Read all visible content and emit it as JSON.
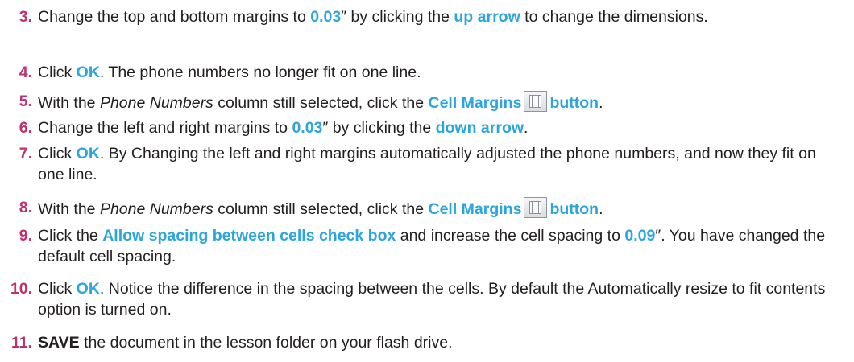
{
  "steps": [
    {
      "number": "3.",
      "segments": [
        {
          "t": "Change the top and bottom margins to "
        },
        {
          "t": "0.03",
          "s": "hl"
        },
        {
          "t": "″ by clicking the "
        },
        {
          "t": "up arrow",
          "s": "hl"
        },
        {
          "t": " to change the dimensions."
        }
      ]
    },
    {
      "number": "4.",
      "segments": [
        {
          "t": "Click "
        },
        {
          "t": "OK",
          "s": "hl"
        },
        {
          "t": ". The phone numbers no longer fit on one line."
        }
      ]
    },
    {
      "number": "5.",
      "segments": [
        {
          "t": "With the "
        },
        {
          "t": "Phone Numbers",
          "s": "i"
        },
        {
          "t": " column still selected, click the "
        },
        {
          "t": "Cell Margins",
          "s": "hl"
        },
        {
          "icon": "cell-margins-icon"
        },
        {
          "t": "button",
          "s": "hl"
        },
        {
          "t": "."
        }
      ]
    },
    {
      "number": "6.",
      "segments": [
        {
          "t": "Change the left and right margins to "
        },
        {
          "t": "0.03",
          "s": "hl"
        },
        {
          "t": "″ by clicking the "
        },
        {
          "t": "down arrow",
          "s": "hl"
        },
        {
          "t": "."
        }
      ]
    },
    {
      "number": "7.",
      "segments": [
        {
          "t": "Click "
        },
        {
          "t": "OK",
          "s": "hl"
        },
        {
          "t": ". By Changing the left and right margins automatically adjusted the phone numbers, and now they fit on one line."
        }
      ]
    },
    {
      "number": "8.",
      "segments": [
        {
          "t": "With the "
        },
        {
          "t": "Phone Numbers",
          "s": "i"
        },
        {
          "t": " column still selected, click the "
        },
        {
          "t": "Cell Margins",
          "s": "hl"
        },
        {
          "icon": "cell-margins-icon"
        },
        {
          "t": "button",
          "s": "hl"
        },
        {
          "t": "."
        }
      ]
    },
    {
      "number": "9.",
      "segments": [
        {
          "t": "Click the "
        },
        {
          "t": "Allow spacing between cells check box",
          "s": "hl"
        },
        {
          "t": " and increase the cell spacing to "
        },
        {
          "t": "0.09",
          "s": "hl"
        },
        {
          "t": "″. You have changed the default cell spacing."
        }
      ]
    },
    {
      "number": "10.",
      "segments": [
        {
          "t": "Click "
        },
        {
          "t": "OK",
          "s": "hl"
        },
        {
          "t": ". Notice the difference in the spacing between the cells. By default the Automatically resize to fit contents option is turned on."
        }
      ]
    },
    {
      "number": "11.",
      "segments": [
        {
          "t": "SAVE",
          "s": "b"
        },
        {
          "t": " the document in the lesson folder on your flash drive."
        }
      ]
    }
  ],
  "colors": {
    "step_number": "#c0306e",
    "highlight": "#2aa6dd",
    "text": "#231f20"
  }
}
